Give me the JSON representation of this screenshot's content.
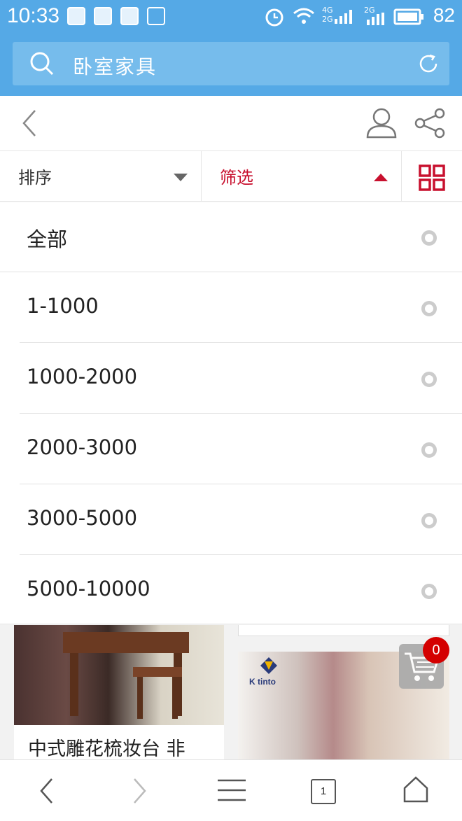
{
  "status_bar": {
    "time": "10:33",
    "battery_level": "82",
    "network_labels": [
      "4G",
      "2G",
      "2G"
    ]
  },
  "search": {
    "query": "卧室家具"
  },
  "filter_bar": {
    "sort_label": "排序",
    "filter_label": "筛选",
    "active_color": "#c8102e"
  },
  "price_filter": {
    "options": [
      {
        "label": "全部"
      },
      {
        "label": "1-1000"
      },
      {
        "label": "1000-2000"
      },
      {
        "label": "2000-3000"
      },
      {
        "label": "3000-5000"
      },
      {
        "label": "5000-10000"
      }
    ]
  },
  "products": {
    "items": [
      {
        "name": "中式雕花梳妆台 非"
      },
      {
        "name": ""
      }
    ],
    "brand_logo_text": "K tinto"
  },
  "cart": {
    "count": "0"
  },
  "bottom_bar": {
    "tab_count": "1"
  },
  "colors": {
    "header_blue": "#55a9e6",
    "accent_red": "#c8102e",
    "badge_red": "#d40000"
  }
}
